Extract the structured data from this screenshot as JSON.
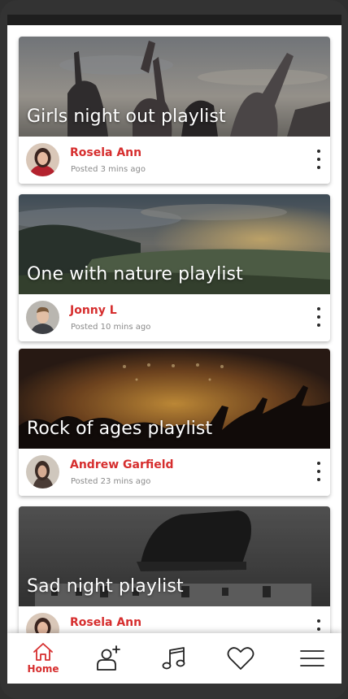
{
  "colors": {
    "accent": "#d62e2e",
    "posted_text": "#8a8a8a",
    "frame": "#333333"
  },
  "feed": [
    {
      "title": "Girls night out playlist",
      "author": "Rosela Ann",
      "posted": "Posted 3 mins ago",
      "image": "concert-crowd-hands-photo",
      "avatar": "rosela-ann-avatar"
    },
    {
      "title": "One with nature playlist",
      "author": "Jonny L",
      "posted": "Posted 10 mins ago",
      "image": "mountain-sunset-photo",
      "avatar": "jonny-l-avatar"
    },
    {
      "title": "Rock of ages playlist",
      "author": "Andrew Garfield",
      "posted": "Posted 23 mins ago",
      "image": "rock-concert-stage-photo",
      "avatar": "andrew-garfield-avatar"
    },
    {
      "title": "Sad night playlist",
      "author": "Rosela Ann",
      "posted": "",
      "image": "shoe-on-dj-mixer-photo",
      "avatar": "rosela-ann-avatar"
    }
  ],
  "nav": {
    "home_label": "Home",
    "items": [
      "home-icon",
      "add-friend-icon",
      "music-note-icon",
      "heart-icon",
      "menu-icon"
    ],
    "active": "home"
  }
}
